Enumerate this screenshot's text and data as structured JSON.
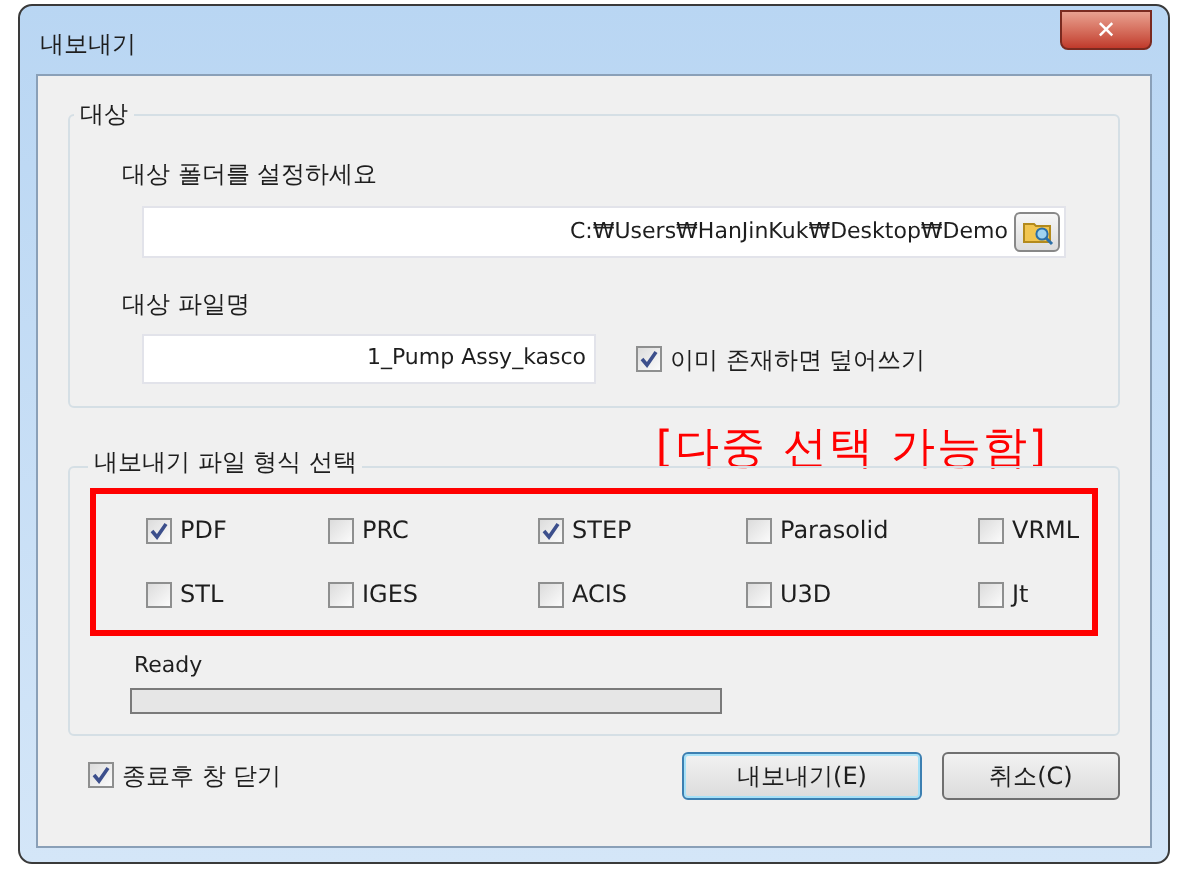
{
  "window": {
    "title": "내보내기",
    "close": "✕"
  },
  "target": {
    "title": "대상",
    "folder_label": "대상 폴더를 설정하세요",
    "folder_value": "C:₩Users₩HanJinKuk₩Desktop₩Demo",
    "file_label": "대상 파일명",
    "file_value": "1_Pump Assy_kasco",
    "overwrite": {
      "label": "이미 존재하면 덮어쓰기",
      "checked": true
    }
  },
  "formats": {
    "title": "내보내기 파일 형식 선택",
    "note": "[다중 선택 가능함]",
    "items": [
      {
        "label": "PDF",
        "checked": true
      },
      {
        "label": "PRC",
        "checked": false
      },
      {
        "label": "STEP",
        "checked": true
      },
      {
        "label": "Parasolid",
        "checked": false
      },
      {
        "label": "VRML",
        "checked": false
      },
      {
        "label": "STL",
        "checked": false
      },
      {
        "label": "IGES",
        "checked": false
      },
      {
        "label": "ACIS",
        "checked": false
      },
      {
        "label": "U3D",
        "checked": false
      },
      {
        "label": "Jt",
        "checked": false
      }
    ],
    "status": "Ready",
    "progress": {
      "level": 0
    }
  },
  "close_after": {
    "label": "종료후 창 닫기",
    "checked": true
  },
  "buttons": [
    {
      "label": "내보내기(E)",
      "kind": "default"
    },
    {
      "label": "취소(C)",
      "kind": "normal"
    }
  ]
}
